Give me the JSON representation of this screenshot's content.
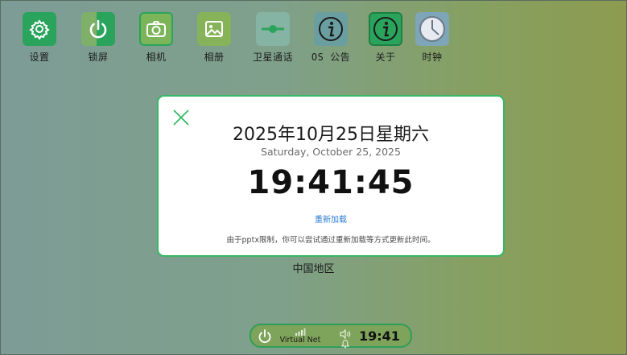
{
  "apps": [
    {
      "label": "设置",
      "icon": "gear-icon"
    },
    {
      "label": "锁屏",
      "icon": "power-icon"
    },
    {
      "label": "相机",
      "icon": "camera-icon"
    },
    {
      "label": "相册",
      "icon": "image-icon"
    },
    {
      "label": "卫星通话",
      "icon": "satellite-icon"
    },
    {
      "label": "OS 公告",
      "icon": "info-icon"
    },
    {
      "label": "关于",
      "icon": "info-icon"
    },
    {
      "label": "时钟",
      "icon": "clock-icon"
    }
  ],
  "dialog": {
    "date_cn": "2025年10月25日星期六",
    "date_en": "Saturday, October 25, 2025",
    "time": "19:41:45",
    "reload_label": "重新加载",
    "note": "由于pptx限制，你可以尝试通过重新加载等方式更新此时间。"
  },
  "region": "中国地区",
  "taskbar": {
    "network_label": "Virtual Net",
    "time": "19:41"
  },
  "colors": {
    "accent_green": "#36b864",
    "link_blue": "#2a7bd3"
  }
}
